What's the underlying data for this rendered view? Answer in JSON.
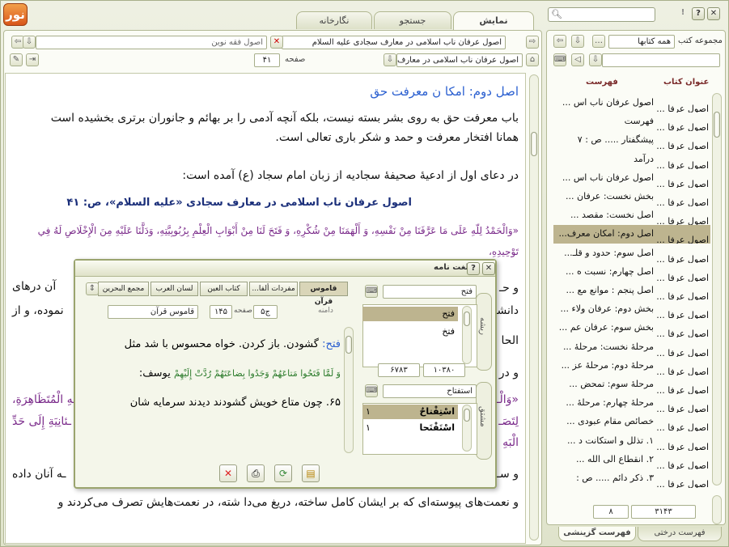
{
  "app": {
    "logo": "نور"
  },
  "tabs": [
    {
      "label": "نمایش"
    },
    {
      "label": "جستجو"
    },
    {
      "label": "نگارخانه"
    }
  ],
  "window_buttons": {
    "close": "✕",
    "help": "?",
    "info": "!"
  },
  "search": {
    "value": ""
  },
  "reader": {
    "doc_tab_title": "اصول عرفان ناب اسلامی در معارف سجادی علیه السلام",
    "second_tab_title": "اصول فقه نوین",
    "book_select": "اصول عرفان ناب اسلامی در معارف ...",
    "page_label": "صفحه",
    "page_value": "۴۱"
  },
  "document": {
    "heading": "اصل دوم: امکا ن معرفت حق",
    "lines": [
      "باب معرفت حق به روی بشر بسته نیست، بلکه آنچه آدمی را بر بهائم و جانوران برتری بخشیده است",
      "همانا افتخار معرفت و حمد و شکر باری تعالی است.",
      "در دعای اول از ادعیهٔ صحیفهٔ سجادیه از زبان امام سجاد (ع) آمده است:",
      "اصول عرفان ناب اسلامی در معارف سجادی «علیه السلام»، ص: ۴۱",
      "«وَالْحَمْدُ لِلّهِ عَلَى مَا عَرَّفَنَا مِنْ نَفْسِهِ، وَ أَلْهَمَنَا مِنْ شُكْرِهِ، وَ فَتَحَ لَنَا مِنْ أَبْوَابِ الْعِلْمِ بِرُبُوبِيَّتِهِ، وَدَلَّنَا عَلَيْهِ مِنَ الْإِخْلَاصِ لَهُ فِي",
      "تَوْحِيدِهِ،",
      "و حـ",
      "دانشـ",
      "الحا",
      "و در",
      "«وَالْـ",
      "لِتَصَـ",
      "الْبَهِ",
      "و سـ",
      "و نعمت‌های پیوسته‌ای که بر ایشان کامل ساخته، دریغ می‌دا شته، در نعمت‌هایش تصرف می‌کردند و"
    ],
    "right_fragments": {
      "r1": "آن درهای",
      "r2": "نموده، و از",
      "r3": "ـهِ الْمُتَظَاهِرَةِ،",
      "r4": "ـئانِيَةِ إِلَى حَدِّ",
      "r5": "ـه آنان داده"
    }
  },
  "library": {
    "collection_label": "مجموعه کتب",
    "collection_value": "همه کتابها",
    "col_title": "عنوان کتاب",
    "col_index": "فهرست",
    "rows": [
      {
        "book": "اصول عرفا ...",
        "index": "اصول عرفان ناب اس ..."
      },
      {
        "book": "اصول عرفا ...",
        "index": "فهرست"
      },
      {
        "book": "اصول عرفا ...",
        "index": "پیشگفتار ..... ص : ۷"
      },
      {
        "book": "اصول عرفا ...",
        "index": "درآمد"
      },
      {
        "book": "اصول عرفا ...",
        "index": "اصول عرفان ناب اس ..."
      },
      {
        "book": "اصول عرفا ...",
        "index": "بخش نخست: عرفان ..."
      },
      {
        "book": "اصول عرفا ...",
        "index": "اصل نخست: مقصد ..."
      },
      {
        "book": "اصول عرفا ...",
        "index": "اصل دوم: امکان معرف..."
      },
      {
        "book": "اصول عرفا ...",
        "index": "اصل سوم: حدود و قلـ..."
      },
      {
        "book": "اصول عرفا ...",
        "index": "اصل چهارم: نسبت ه ..."
      },
      {
        "book": "اصول عرفا ...",
        "index": "اصل پنجم : موانع مع ..."
      },
      {
        "book": "اصول عرفا ...",
        "index": "بخش دوم: عرفان ولاء ..."
      },
      {
        "book": "اصول عرفا ...",
        "index": "بخش سوم: عرفان عم ..."
      },
      {
        "book": "اصول عرفا ...",
        "index": "مرحلهٔ نخست: مرحلهٔ ..."
      },
      {
        "book": "اصول عرفا ...",
        "index": "مرحلهٔ دوم: مرحلهٔ عز ..."
      },
      {
        "book": "اصول عرفا ...",
        "index": "مرحلهٔ سوم: تمحض ..."
      },
      {
        "book": "اصول عرفا ...",
        "index": "مرحلهٔ چهارم: مرحلهٔ ..."
      },
      {
        "book": "اصول عرفا ...",
        "index": "خصائص مقام عبودی ..."
      },
      {
        "book": "اصول عرفا ...",
        "index": "۱. تذلل و استکانت د ..."
      },
      {
        "book": "اصول عرفا ...",
        "index": "۲. انقطاع الی الله ..."
      },
      {
        "book": "اصول عرفا ...",
        "index": "۳. ذکر دائم ..... ص :"
      }
    ],
    "count_total": "۳۱۴۳",
    "count_current": "۸",
    "bottom_tab_tree": "فهرست درختی",
    "bottom_tab_select": "فهرست گزینشی"
  },
  "dictionary": {
    "title": "لغت نامه",
    "tabs": [
      "قاموس قرآن",
      "مفردات ألفا...",
      "کتاب العین",
      "لسان العرب",
      "مجمع البحرین"
    ],
    "root_label": "ریشه",
    "root_input": "فتح",
    "roots": [
      "فتح",
      "فتخ"
    ],
    "root_counts": {
      "left": "۶۷۸۳",
      "right": "۱۰۳۸۰"
    },
    "derived_label": "مشتق",
    "derived_input": "استفتاح",
    "derived": [
      {
        "word": "اسْتِفْتاحٌ",
        "count": "۱"
      },
      {
        "word": "اسْتَفْتَحا",
        "count": "۱"
      }
    ],
    "book_label": "قاموس قرآن",
    "page_label": "صفحه",
    "page_value": "۱۴۵",
    "volume_value": "ج۵",
    "domain_label": "دامنه",
    "entry_head": "فتح:",
    "entry_text": "گشودن. باز کردن. خواه محسوس با شد مثل",
    "entry_verse": "وَ لَمَّا فَتَحُوا مَتاعَهُمْ وَجَدُوا بِضاعَتَهُمْ رُدَّتْ إِلَيْهِمْ",
    "entry_ref": "یوسف:",
    "entry_text2": "۶۵. چون متاع خویش گشودند دیدند سرمایه شان"
  }
}
